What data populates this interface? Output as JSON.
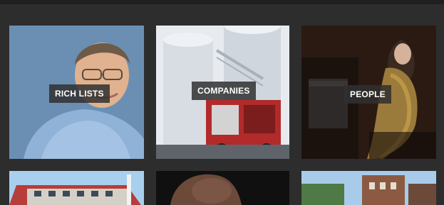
{
  "tiles": [
    {
      "label": "RICH LISTS"
    },
    {
      "label": "COMPANIES"
    },
    {
      "label": "PEOPLE"
    }
  ],
  "colors": {
    "background": "#2d2d2d",
    "label_bg": "#303030",
    "label_text": "#ffffff"
  }
}
